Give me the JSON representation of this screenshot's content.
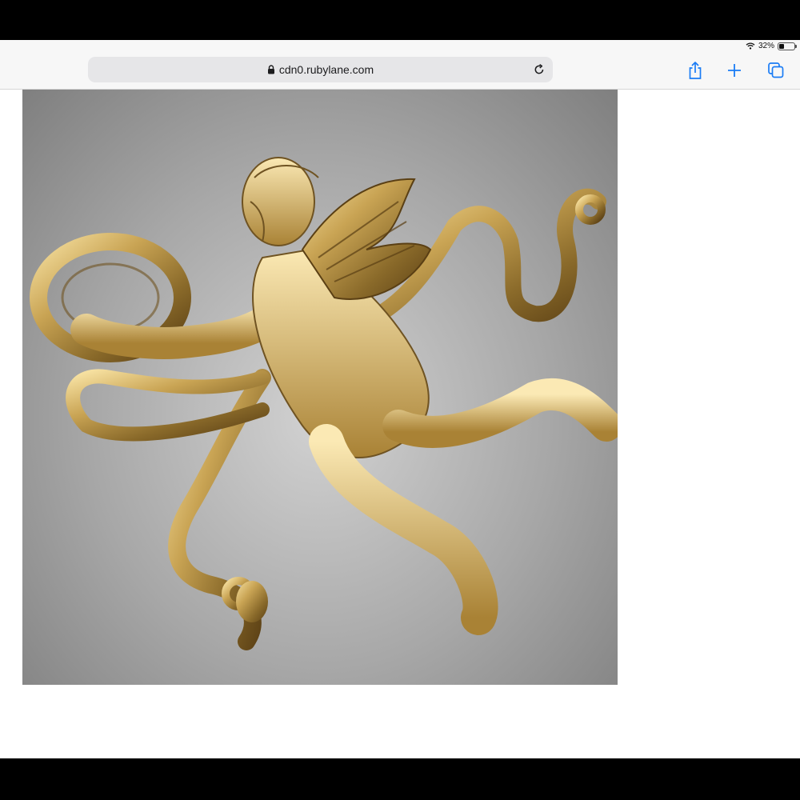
{
  "status_bar": {
    "battery_text": "32%",
    "battery_level": 0.32,
    "icons": [
      "wifi-icon",
      "battery-icon"
    ]
  },
  "browser": {
    "url": "cdn0.rubylane.com",
    "icons": [
      "lock-icon",
      "reload-icon",
      "share-icon",
      "plus-icon",
      "tabs-icon"
    ]
  },
  "content": {
    "image": {
      "subject": "gold cherub brooch with ribbon and wreath",
      "background_colors": [
        "#d2d2d2",
        "#7f7f7f"
      ],
      "metal_colors": [
        "#f6e0a0",
        "#c9a454",
        "#8a6a2a",
        "#5a3f14"
      ]
    }
  }
}
